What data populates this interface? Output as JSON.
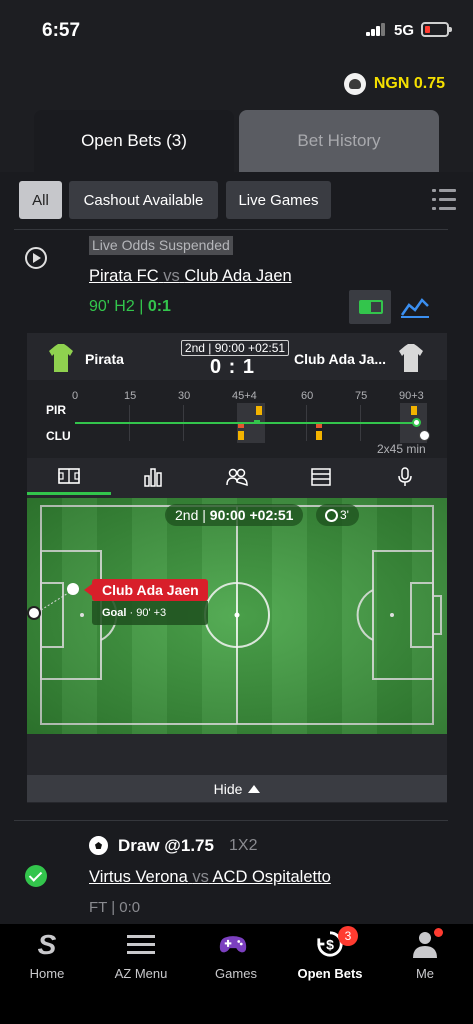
{
  "status_bar": {
    "time": "6:57",
    "network": "5G"
  },
  "account": {
    "balance": "NGN 0.75"
  },
  "tabs": {
    "open_bets": "Open Bets (3)",
    "bet_history": "Bet History"
  },
  "filters": [
    "All",
    "Cashout Available",
    "Live Games"
  ],
  "bet1": {
    "suspended_label": "Live Odds Suspended",
    "home_team": "Pirata FC",
    "vs": "vs",
    "away_team": "Club Ada Jaen",
    "status_prefix": "90' H2 |",
    "score": "0:1"
  },
  "tracker": {
    "home_short": "Pirata",
    "away_short": "Club Ada Ja...",
    "period_box": "2nd | 90:00 +02:51",
    "score": "0 : 1",
    "timeline_labels": [
      "0",
      "15",
      "30",
      "45+4",
      "60",
      "75",
      "90+3"
    ],
    "row_home": "PIR",
    "row_away": "CLU",
    "duration": "2x45 min",
    "pitch_period": "2nd",
    "pitch_time": "90:00 +02:51",
    "timer": "3'",
    "event_team": "Club Ada Jaen",
    "event_type": "Goal",
    "event_time": "· 90' +3",
    "hide_label": "Hide"
  },
  "bet2": {
    "pick": "Draw @1.75",
    "market": "1X2",
    "home_team": "Virtus Verona",
    "vs": "vs",
    "away_team": "ACD Ospitaletto",
    "result": "FT | 0:0"
  },
  "nav": [
    {
      "label": "Home",
      "icon": "sportybet-logo-icon"
    },
    {
      "label": "AZ Menu",
      "icon": "hamburger-menu-icon"
    },
    {
      "label": "Games",
      "icon": "gamepad-icon"
    },
    {
      "label": "Open Bets",
      "icon": "open-bets-icon",
      "badge": "3"
    },
    {
      "label": "Me",
      "icon": "user-icon"
    }
  ],
  "colors": {
    "accent_green": "#33c54c",
    "balance_yellow": "#f5e000",
    "alert_red": "#d81f2a"
  }
}
